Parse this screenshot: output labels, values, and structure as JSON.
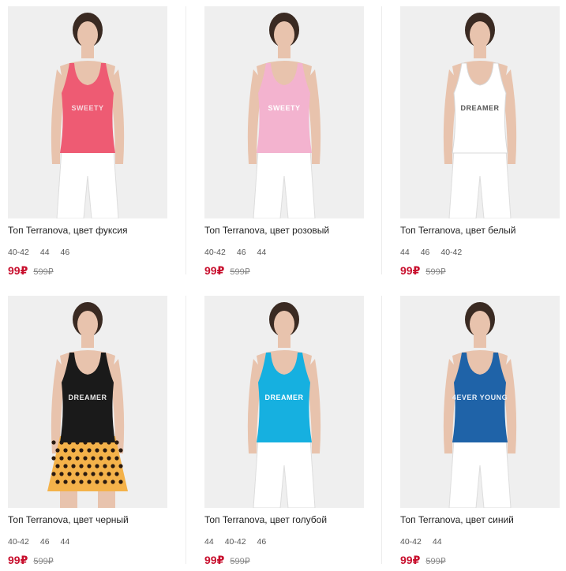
{
  "products": [
    {
      "title": "Топ Terranova, цвет фуксия",
      "print": "SWEETY",
      "print_color": "#f6d6dc",
      "top_color": "#ee5b73",
      "bottom_color": "#ffffff",
      "bottom": "pants",
      "sizes": [
        "40-42",
        "44",
        "46"
      ],
      "price": "99₽",
      "old_price": "599₽"
    },
    {
      "title": "Топ Terranova, цвет розовый",
      "print": "SWEETY",
      "print_color": "#ffffff",
      "top_color": "#f3b3cf",
      "bottom_color": "#ffffff",
      "bottom": "pants",
      "sizes": [
        "40-42",
        "46",
        "44"
      ],
      "price": "99₽",
      "old_price": "599₽"
    },
    {
      "title": "Топ Terranova, цвет белый",
      "print": "DREAMER",
      "print_color": "#555555",
      "top_color": "#ffffff",
      "bottom_color": "#ffffff",
      "bottom": "pants",
      "sizes": [
        "44",
        "46",
        "40-42"
      ],
      "price": "99₽",
      "old_price": "599₽"
    },
    {
      "title": "Топ Terranova, цвет черный",
      "print": "DREAMER",
      "print_color": "#e8e8e8",
      "top_color": "#1a1a1a",
      "bottom_color": "#f4b24a",
      "bottom": "skirt",
      "sizes": [
        "40-42",
        "46",
        "44"
      ],
      "price": "99₽",
      "old_price": "599₽"
    },
    {
      "title": "Топ Terranova, цвет голубой",
      "print": "DREAMER",
      "print_color": "#ffffff",
      "top_color": "#16b0e0",
      "bottom_color": "#ffffff",
      "bottom": "pants",
      "sizes": [
        "44",
        "40-42",
        "46"
      ],
      "price": "99₽",
      "old_price": "599₽"
    },
    {
      "title": "Топ Terranova, цвет синий",
      "print": "4EVER YOUNG",
      "print_color": "#e6eef8",
      "top_color": "#1f63a8",
      "bottom_color": "#ffffff",
      "bottom": "pants",
      "sizes": [
        "40-42",
        "44"
      ],
      "price": "99₽",
      "old_price": "599₽"
    }
  ],
  "colors": {
    "price": "#c8102e",
    "old_price": "#888888",
    "photo_bg": "#efefef",
    "skin": "#e8c3ad",
    "hair": "#3a2a22"
  }
}
